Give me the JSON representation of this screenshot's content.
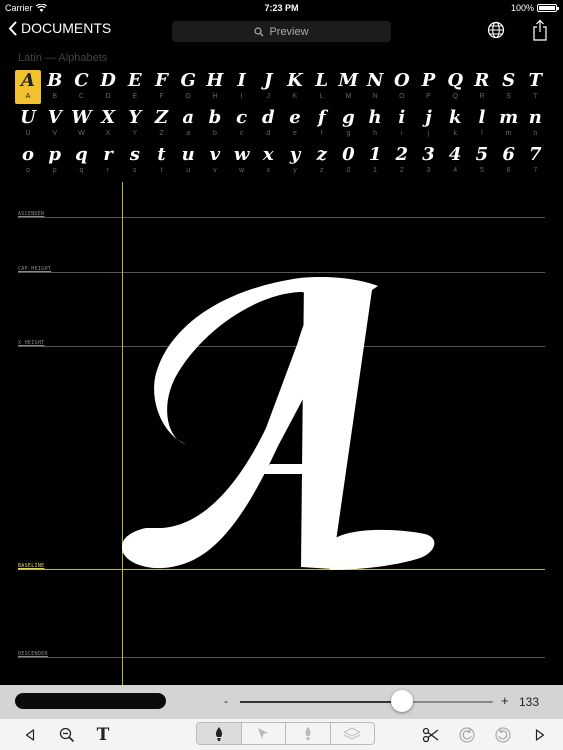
{
  "status": {
    "carrier": "Carrier",
    "time": "7:23 PM",
    "battery": "100%"
  },
  "nav": {
    "back_label": "DOCUMENTS",
    "preview_label": "Preview"
  },
  "glyph_set": {
    "title": "Latin — Alphabets",
    "selected": "A",
    "rows": [
      [
        [
          "A",
          "A"
        ],
        [
          "B",
          "B"
        ],
        [
          "C",
          "C"
        ],
        [
          "D",
          "D"
        ],
        [
          "E",
          "E"
        ],
        [
          "F",
          "F"
        ],
        [
          "G",
          "G"
        ],
        [
          "H",
          "H"
        ],
        [
          "I",
          "I"
        ],
        [
          "J",
          "J"
        ],
        [
          "K",
          "K"
        ],
        [
          "L",
          "L"
        ],
        [
          "M",
          "M"
        ],
        [
          "N",
          "N"
        ],
        [
          "O",
          "O"
        ],
        [
          "P",
          "P"
        ],
        [
          "Q",
          "Q"
        ],
        [
          "R",
          "R"
        ],
        [
          "S",
          "S"
        ],
        [
          "T",
          "T"
        ]
      ],
      [
        [
          "U",
          "U"
        ],
        [
          "V",
          "V"
        ],
        [
          "W",
          "W"
        ],
        [
          "X",
          "X"
        ],
        [
          "Y",
          "Y"
        ],
        [
          "Z",
          "Z"
        ],
        [
          "a",
          "a"
        ],
        [
          "b",
          "b"
        ],
        [
          "c",
          "c"
        ],
        [
          "d",
          "d"
        ],
        [
          "e",
          "e"
        ],
        [
          "f",
          "f"
        ],
        [
          "g",
          "g"
        ],
        [
          "h",
          "h"
        ],
        [
          "i",
          "i"
        ],
        [
          "j",
          "j"
        ],
        [
          "k",
          "k"
        ],
        [
          "l",
          "l"
        ],
        [
          "m",
          "m"
        ],
        [
          "n",
          "n"
        ]
      ],
      [
        [
          "o",
          "o"
        ],
        [
          "p",
          "p"
        ],
        [
          "q",
          "q"
        ],
        [
          "r",
          "r"
        ],
        [
          "s",
          "s"
        ],
        [
          "t",
          "t"
        ],
        [
          "u",
          "u"
        ],
        [
          "v",
          "v"
        ],
        [
          "w",
          "w"
        ],
        [
          "x",
          "x"
        ],
        [
          "y",
          "y"
        ],
        [
          "z",
          "z"
        ],
        [
          "0",
          "0"
        ],
        [
          "1",
          "1"
        ],
        [
          "2",
          "2"
        ],
        [
          "3",
          "3"
        ],
        [
          "4",
          "4"
        ],
        [
          "5",
          "5"
        ],
        [
          "6",
          "6"
        ],
        [
          "7",
          "7"
        ]
      ]
    ]
  },
  "metrics": {
    "ascender": "ASCENDER",
    "cap_height": "CAP HEIGHT",
    "x_height": "X HEIGHT",
    "baseline": "BASELINE",
    "descender": "DESCENDER"
  },
  "size_slider": {
    "minus": "-",
    "plus": "+",
    "value": "133",
    "level": 0.64
  },
  "icons": {
    "back": "chevron-left-icon",
    "search": "search-icon",
    "globe": "globe-icon",
    "share": "share-icon",
    "prev": "triangle-left-icon",
    "zoom": "zoom-out-icon",
    "text": "text-tool-icon",
    "pen": "pen-icon",
    "pointer": "pointer-icon",
    "brush": "brush-icon",
    "layers": "layers-icon",
    "scissors": "scissors-icon",
    "undo": "undo-icon",
    "redo": "redo-icon",
    "next": "triangle-right-icon"
  },
  "toolbar": {
    "text_tool": "T"
  },
  "colors": {
    "accent": "#f2c12e",
    "guide": "#bcb23f",
    "glyph": "#ffffff",
    "background": "#000000"
  }
}
